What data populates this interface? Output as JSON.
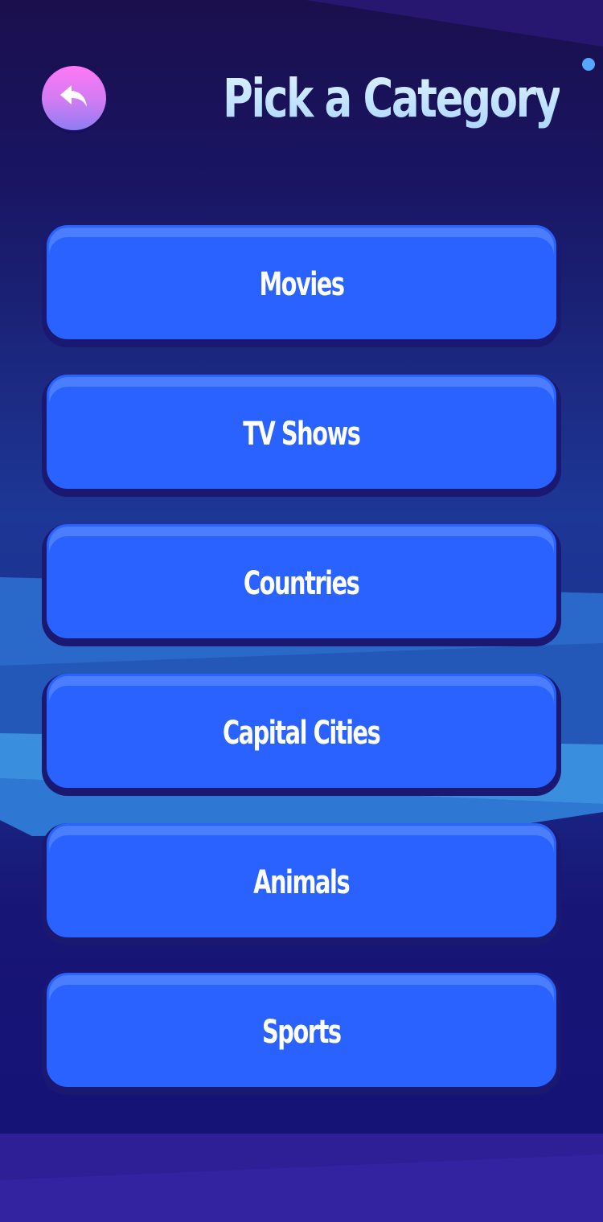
{
  "header": {
    "title": "Pick a Category",
    "back_icon": "back-arrow-icon"
  },
  "categories": [
    {
      "label": "Movies"
    },
    {
      "label": "TV Shows"
    },
    {
      "label": "Countries"
    },
    {
      "label": "Capital Cities"
    },
    {
      "label": "Animals"
    },
    {
      "label": "Sports"
    }
  ],
  "colors": {
    "background": "#171470",
    "button": "#2a62ff",
    "button_highlight": "#4b7dff",
    "back_button_top": "#ff78f4",
    "back_button_bottom": "#8d7cf2",
    "title": "#cfe9ff"
  }
}
